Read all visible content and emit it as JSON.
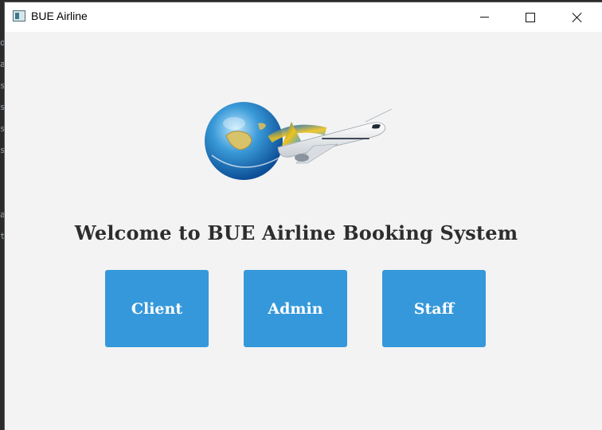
{
  "window": {
    "title": "BUE Airline",
    "controls": {
      "minimize_icon": "minimize-icon",
      "maximize_icon": "maximize-icon",
      "close_icon": "close-icon"
    }
  },
  "main": {
    "logo_icon": "globe-airplane-logo",
    "welcome_text": "Welcome to BUE Airline Booking System",
    "buttons": [
      {
        "label": "Client",
        "color": "#3598db"
      },
      {
        "label": "Admin",
        "color": "#3598db"
      },
      {
        "label": "Staff",
        "color": "#3598db"
      }
    ]
  },
  "background_editor": {
    "gutter_chars": [
      "o",
      "a",
      "s",
      "s",
      "s",
      "s",
      "",
      "",
      "a",
      "t"
    ]
  }
}
